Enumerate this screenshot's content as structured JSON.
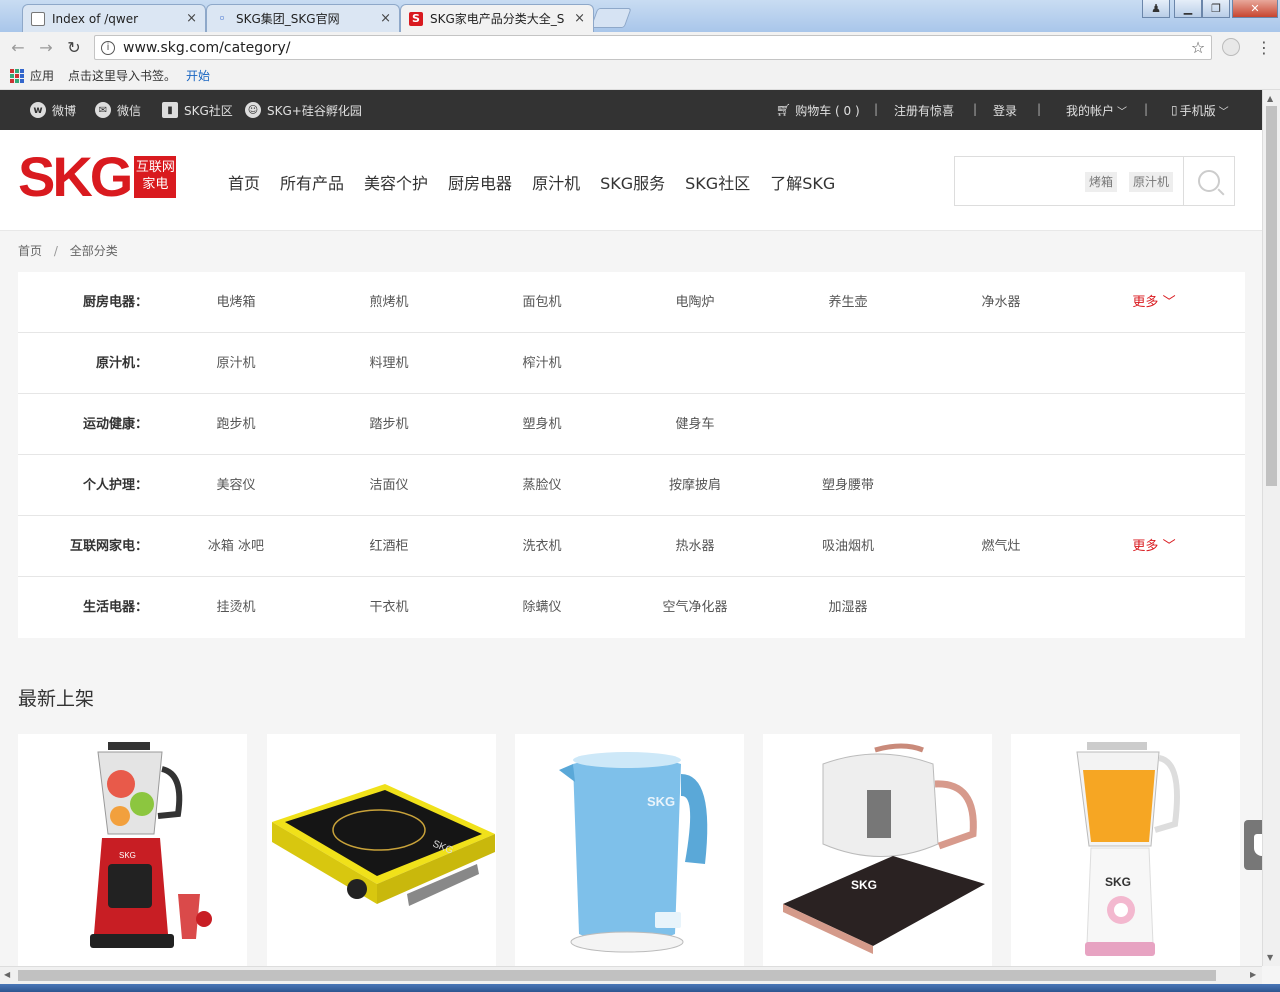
{
  "browser": {
    "tabs": [
      {
        "title": "Index of /qwer",
        "close": "×"
      },
      {
        "title": "SKG集团_SKG官网",
        "close": "×"
      },
      {
        "title": "SKG家电产品分类大全_S",
        "close": "×",
        "favicon": "S"
      }
    ],
    "url": "www.skg.com/category/",
    "bookmarks_apps": "应用",
    "bookmarks_hint": "点击这里导入书签。",
    "bookmarks_start": "开始"
  },
  "topbar": {
    "weibo": "微博",
    "weixin": "微信",
    "community": "SKG社区",
    "incubator": "SKG+硅谷孵化园",
    "cart": "购物车 ( 0 )",
    "register": "注册有惊喜",
    "login": "登录",
    "account": "我的帐户",
    "mobile": "手机版"
  },
  "logo": {
    "word": "SKG",
    "badge_line1": "互联网",
    "badge_line2": "家电"
  },
  "nav": [
    "首页",
    "所有产品",
    "美容个护",
    "厨房电器",
    "原汁机",
    "SKG服务",
    "SKG社区",
    "了解SKG"
  ],
  "search": {
    "tags": [
      "烤箱",
      "原汁机"
    ]
  },
  "breadcrumb": {
    "home": "首页",
    "sep": "/",
    "current": "全部分类"
  },
  "categories": [
    {
      "label": "厨房电器：",
      "items": [
        "电烤箱",
        "煎烤机",
        "面包机",
        "电陶炉",
        "养生壶",
        "净水器"
      ],
      "more": "更多"
    },
    {
      "label": "原汁机：",
      "items": [
        "原汁机",
        "料理机",
        "榨汁机"
      ]
    },
    {
      "label": "运动健康：",
      "items": [
        "跑步机",
        "踏步机",
        "塑身机",
        "健身车"
      ]
    },
    {
      "label": "个人护理：",
      "items": [
        "美容仪",
        "洁面仪",
        "蒸脸仪",
        "按摩披肩",
        "塑身腰带"
      ]
    },
    {
      "label": "互联网家电：",
      "items": [
        "冰箱 冰吧",
        "红酒柜",
        "洗衣机",
        "热水器",
        "吸油烟机",
        "燃气灶"
      ],
      "more": "更多"
    },
    {
      "label": "生活电器：",
      "items": [
        "挂烫机",
        "干衣机",
        "除螨仪",
        "空气净化器",
        "加湿器"
      ]
    }
  ],
  "new_section": {
    "title": "最新上架"
  },
  "products": [
    {
      "icon": "blender-image",
      "brand": "SKG"
    },
    {
      "icon": "induction-cooker-image",
      "brand": "SKG"
    },
    {
      "icon": "kettle-image",
      "brand": "SKG"
    },
    {
      "icon": "health-pot-image",
      "brand": "SKG"
    },
    {
      "icon": "juicer-image",
      "brand": "SKG"
    }
  ],
  "colors": {
    "brand_red": "#d91a1f",
    "topbar_bg": "#333333"
  }
}
